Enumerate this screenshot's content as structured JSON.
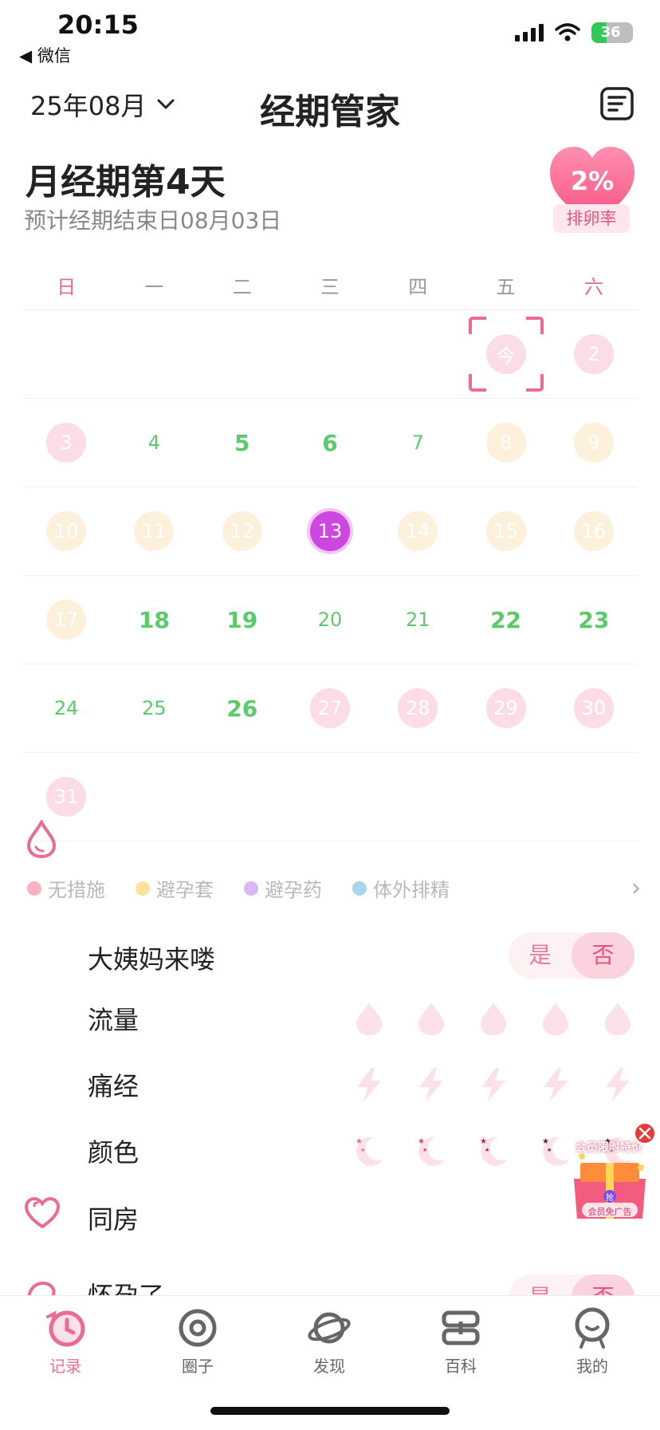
{
  "status_bar": {
    "time": "20:15",
    "back_label": "◀ 微信",
    "battery": "36",
    "battery_level": 0.36
  },
  "header": {
    "month": "25年08月",
    "title": "经期管家"
  },
  "summary": {
    "period_day": "月经期第4天",
    "end_date": "预计经期结束日08月03日",
    "ovulation_rate": "2%",
    "ovulation_label": "排卵率"
  },
  "weekdays": [
    "日",
    "一",
    "二",
    "三",
    "四",
    "五",
    "六"
  ],
  "calendar": [
    [
      {
        "t": ""
      },
      {
        "t": ""
      },
      {
        "t": ""
      },
      {
        "t": ""
      },
      {
        "t": ""
      },
      {
        "t": "今",
        "k": "period",
        "today": true
      },
      {
        "t": "2",
        "k": "period"
      }
    ],
    [
      {
        "t": "3",
        "k": "period"
      },
      {
        "t": "4",
        "k": "safe"
      },
      {
        "t": "5",
        "k": "safe big"
      },
      {
        "t": "6",
        "k": "safe big"
      },
      {
        "t": "7",
        "k": "safe"
      },
      {
        "t": "8",
        "k": "fertile"
      },
      {
        "t": "9",
        "k": "fertile"
      }
    ],
    [
      {
        "t": "10",
        "k": "fertile"
      },
      {
        "t": "11",
        "k": "fertile"
      },
      {
        "t": "12",
        "k": "fertile"
      },
      {
        "t": "13",
        "k": "ovulation"
      },
      {
        "t": "14",
        "k": "fertile"
      },
      {
        "t": "15",
        "k": "fertile"
      },
      {
        "t": "16",
        "k": "fertile"
      }
    ],
    [
      {
        "t": "17",
        "k": "fertile"
      },
      {
        "t": "18",
        "k": "safe big"
      },
      {
        "t": "19",
        "k": "safe big"
      },
      {
        "t": "20",
        "k": "safe"
      },
      {
        "t": "21",
        "k": "safe"
      },
      {
        "t": "22",
        "k": "safe big"
      },
      {
        "t": "23",
        "k": "safe big"
      }
    ],
    [
      {
        "t": "24",
        "k": "safe"
      },
      {
        "t": "25",
        "k": "safe"
      },
      {
        "t": "26",
        "k": "safe big"
      },
      {
        "t": "27",
        "k": "period"
      },
      {
        "t": "28",
        "k": "period"
      },
      {
        "t": "29",
        "k": "period"
      },
      {
        "t": "30",
        "k": "period"
      }
    ],
    [
      {
        "t": "31",
        "k": "period"
      },
      {
        "t": ""
      },
      {
        "t": ""
      },
      {
        "t": ""
      },
      {
        "t": ""
      },
      {
        "t": ""
      },
      {
        "t": ""
      }
    ]
  ],
  "legend": [
    {
      "label": "无措施",
      "color": "#f7b3c4"
    },
    {
      "label": "避孕套",
      "color": "#fbe39c"
    },
    {
      "label": "避孕药",
      "color": "#d9b8f5"
    },
    {
      "label": "体外排精",
      "color": "#a9d6ef"
    }
  ],
  "records": {
    "period_came": {
      "label": "大姨妈来喽",
      "yes": "是",
      "no": "否"
    },
    "flow_label": "流量",
    "pain_label": "痛经",
    "color_label": "颜色",
    "intimacy_label": "同房",
    "pregnancy_label": "怀孕了",
    "pregnancy_yes": "是",
    "pregnancy_no": "否"
  },
  "ad": {
    "title": "会员限时特价",
    "tag": "抢",
    "subtitle": "会员免广告"
  },
  "tabs": [
    {
      "label": "记录",
      "icon": "clock-icon",
      "active": true
    },
    {
      "label": "圈子",
      "icon": "at-icon"
    },
    {
      "label": "发现",
      "icon": "planet-icon"
    },
    {
      "label": "百科",
      "icon": "book-icon"
    },
    {
      "label": "我的",
      "icon": "profile-icon"
    }
  ],
  "colors": {
    "accent": "#ec6b92",
    "period": "#fcdde6",
    "fertile": "#fdf1dc",
    "ovulation": "#cc46e0",
    "safe": "#5cc96a"
  }
}
